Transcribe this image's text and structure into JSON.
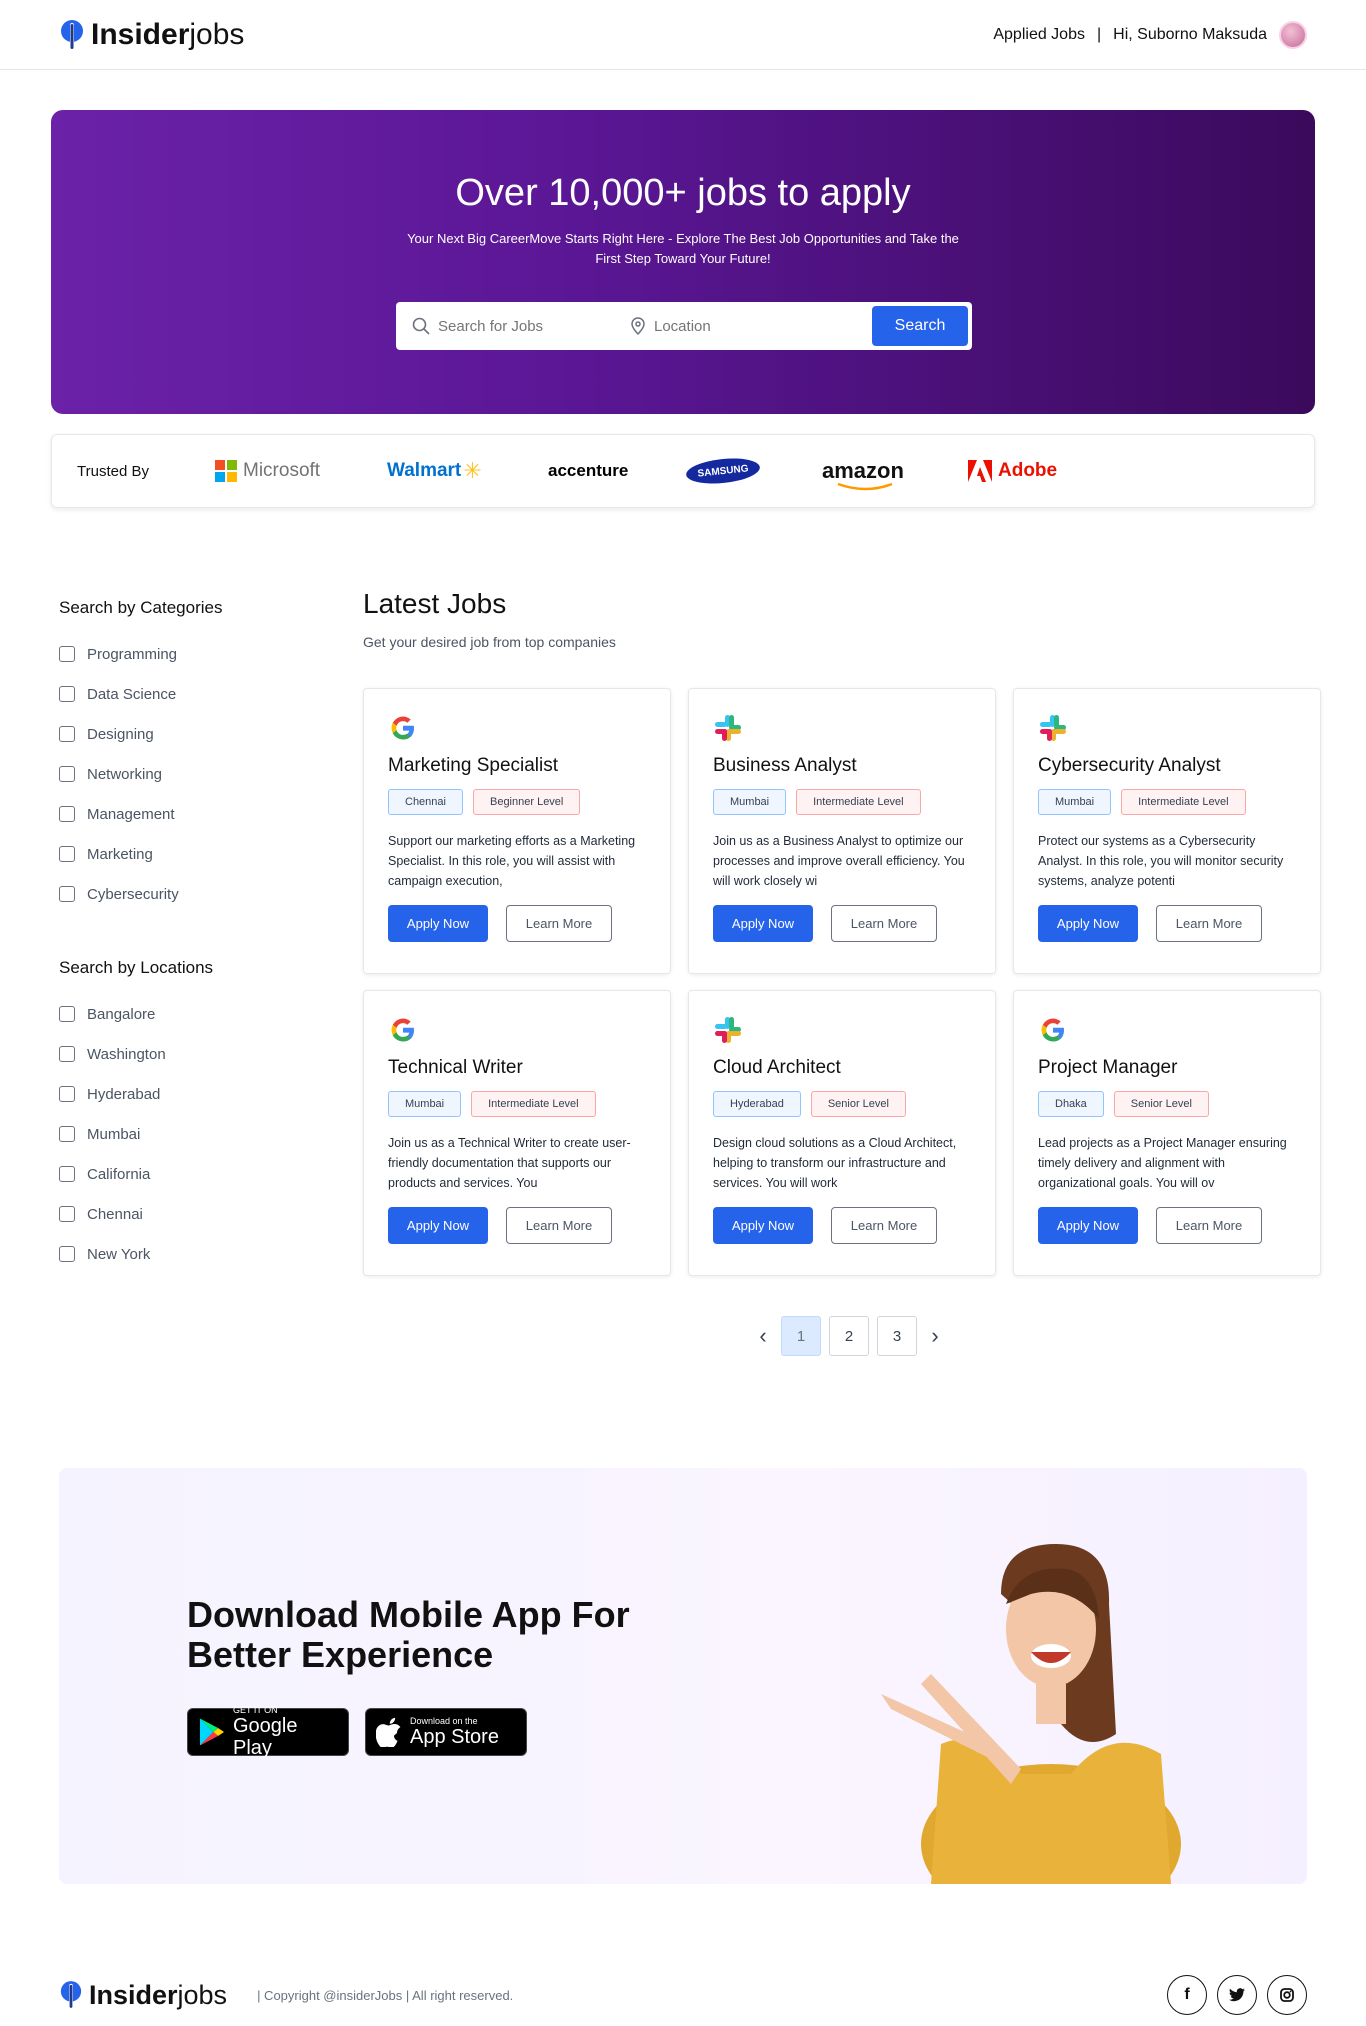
{
  "nav": {
    "logo_bold": "Insider",
    "logo_light": "jobs",
    "applied_jobs": "Applied Jobs",
    "separator": "|",
    "greeting": "Hi, Suborno Maksuda"
  },
  "hero": {
    "title": "Over 10,000+ jobs to apply",
    "subtitle": "Your Next Big CareerMove Starts Right Here - Explore The Best Job Opportunities and Take the First Step Toward Your Future!",
    "search_placeholder": "Search for Jobs",
    "location_placeholder": "Location",
    "search_button": "Search"
  },
  "trusted": {
    "label": "Trusted By",
    "brands": [
      {
        "name": "Microsoft",
        "color": "#737373"
      },
      {
        "name": "Walmart",
        "color": "#0071ce"
      },
      {
        "name": "accenture",
        "color": "#000000"
      },
      {
        "name": "SAMSUNG",
        "color": "#1428a0"
      },
      {
        "name": "amazon",
        "color": "#111111"
      },
      {
        "name": "Adobe",
        "color": "#eb1000"
      }
    ]
  },
  "sidebar": {
    "categories_title": "Search by Categories",
    "categories": [
      "Programming",
      "Data Science",
      "Designing",
      "Networking",
      "Management",
      "Marketing",
      "Cybersecurity"
    ],
    "locations_title": "Search by Locations",
    "locations": [
      "Bangalore",
      "Washington",
      "Hyderabad",
      "Mumbai",
      "California",
      "Chennai",
      "New York"
    ]
  },
  "jobs": {
    "title": "Latest Jobs",
    "subtitle": "Get your desired job from top companies",
    "apply_label": "Apply Now",
    "learn_label": "Learn More",
    "cards": [
      {
        "icon": "google-icon",
        "title": "Marketing Specialist",
        "location": "Chennai",
        "level": "Beginner Level",
        "desc": "Support our marketing efforts as a Marketing Specialist. In this role, you will assist with campaign execution,"
      },
      {
        "icon": "slack-icon",
        "title": "Business Analyst",
        "location": "Mumbai",
        "level": "Intermediate Level",
        "desc": "Join us as a Business Analyst to optimize our processes and improve overall efficiency. You will work closely wi"
      },
      {
        "icon": "slack-icon",
        "title": "Cybersecurity Analyst",
        "location": "Mumbai",
        "level": "Intermediate Level",
        "desc": "Protect our systems as a Cybersecurity Analyst. In this role, you will monitor security systems, analyze potenti"
      },
      {
        "icon": "google-icon",
        "title": "Technical Writer",
        "location": "Mumbai",
        "level": "Intermediate Level",
        "desc": "Join us as a Technical Writer to create user-friendly documentation that supports our products and services. You"
      },
      {
        "icon": "slack-icon",
        "title": "Cloud Architect",
        "location": "Hyderabad",
        "level": "Senior Level",
        "desc": "Design cloud solutions as a Cloud Architect, helping to transform our infrastructure and services. You will work"
      },
      {
        "icon": "google-icon",
        "title": "Project Manager",
        "location": "Dhaka",
        "level": "Senior Level",
        "desc": "Lead projects as a Project Manager ensuring timely delivery and alignment with organizational goals. You will ov"
      }
    ]
  },
  "pagination": {
    "pages": [
      "1",
      "2",
      "3"
    ],
    "current": "1"
  },
  "promo": {
    "title": "Download Mobile App For Better Experience",
    "google_small": "GET IT ON",
    "google_big": "Google Play",
    "apple_small": "Download on the",
    "apple_big": "App Store"
  },
  "footer": {
    "logo_bold": "Insider",
    "logo_light": "jobs",
    "copyright": "| Copyright @insiderJobs | All right reserved."
  }
}
